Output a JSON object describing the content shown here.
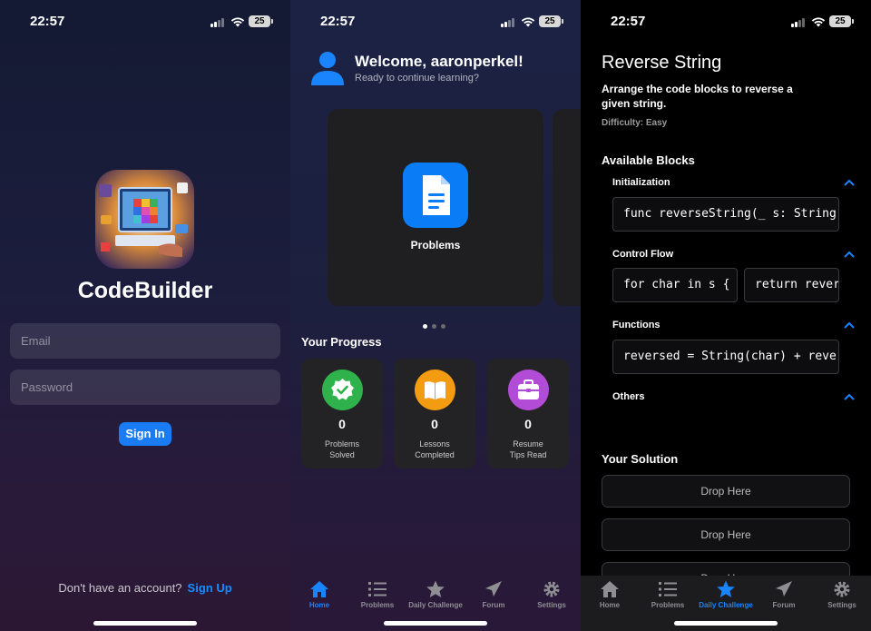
{
  "status": {
    "time": "22:57",
    "battery": "25"
  },
  "login": {
    "app_name": "CodeBuilder",
    "email_placeholder": "Email",
    "password_placeholder": "Password",
    "signin_label": "Sign In",
    "no_account_text": "Don't have an account?",
    "signup_label": "Sign Up"
  },
  "home": {
    "welcome": "Welcome, aaronperkel!",
    "subtitle": "Ready to continue learning?",
    "card_label": "Problems",
    "progress_title": "Your Progress",
    "progress": [
      {
        "value": "0",
        "line1": "Problems",
        "line2": "Solved",
        "color": "#2fb24b"
      },
      {
        "value": "0",
        "line1": "Lessons",
        "line2": "Completed",
        "color": "#f39c12"
      },
      {
        "value": "0",
        "line1": "Resume",
        "line2": "Tips Read",
        "color": "#b24bd6"
      }
    ]
  },
  "challenge": {
    "title": "Reverse String",
    "description": "Arrange the code blocks to reverse a given string.",
    "difficulty": "Difficulty: Easy",
    "available_title": "Available Blocks",
    "categories": [
      {
        "name": "Initialization",
        "blocks": [
          "func reverseString(_ s: String) -> String {"
        ]
      },
      {
        "name": "Control Flow",
        "blocks": [
          "for char in s {",
          "return reversed"
        ]
      },
      {
        "name": "Functions",
        "blocks": [
          "reversed = String(char) + reversed"
        ]
      },
      {
        "name": "Others",
        "blocks": []
      }
    ],
    "solution_title": "Your Solution",
    "drop_label": "Drop Here",
    "drop_label_partial": "Drop Here"
  },
  "tabs": [
    "Home",
    "Problems",
    "Daily Challenge",
    "Forum",
    "Settings"
  ],
  "colors": {
    "accent": "#1a84ff",
    "inactive": "#8e8e93"
  }
}
